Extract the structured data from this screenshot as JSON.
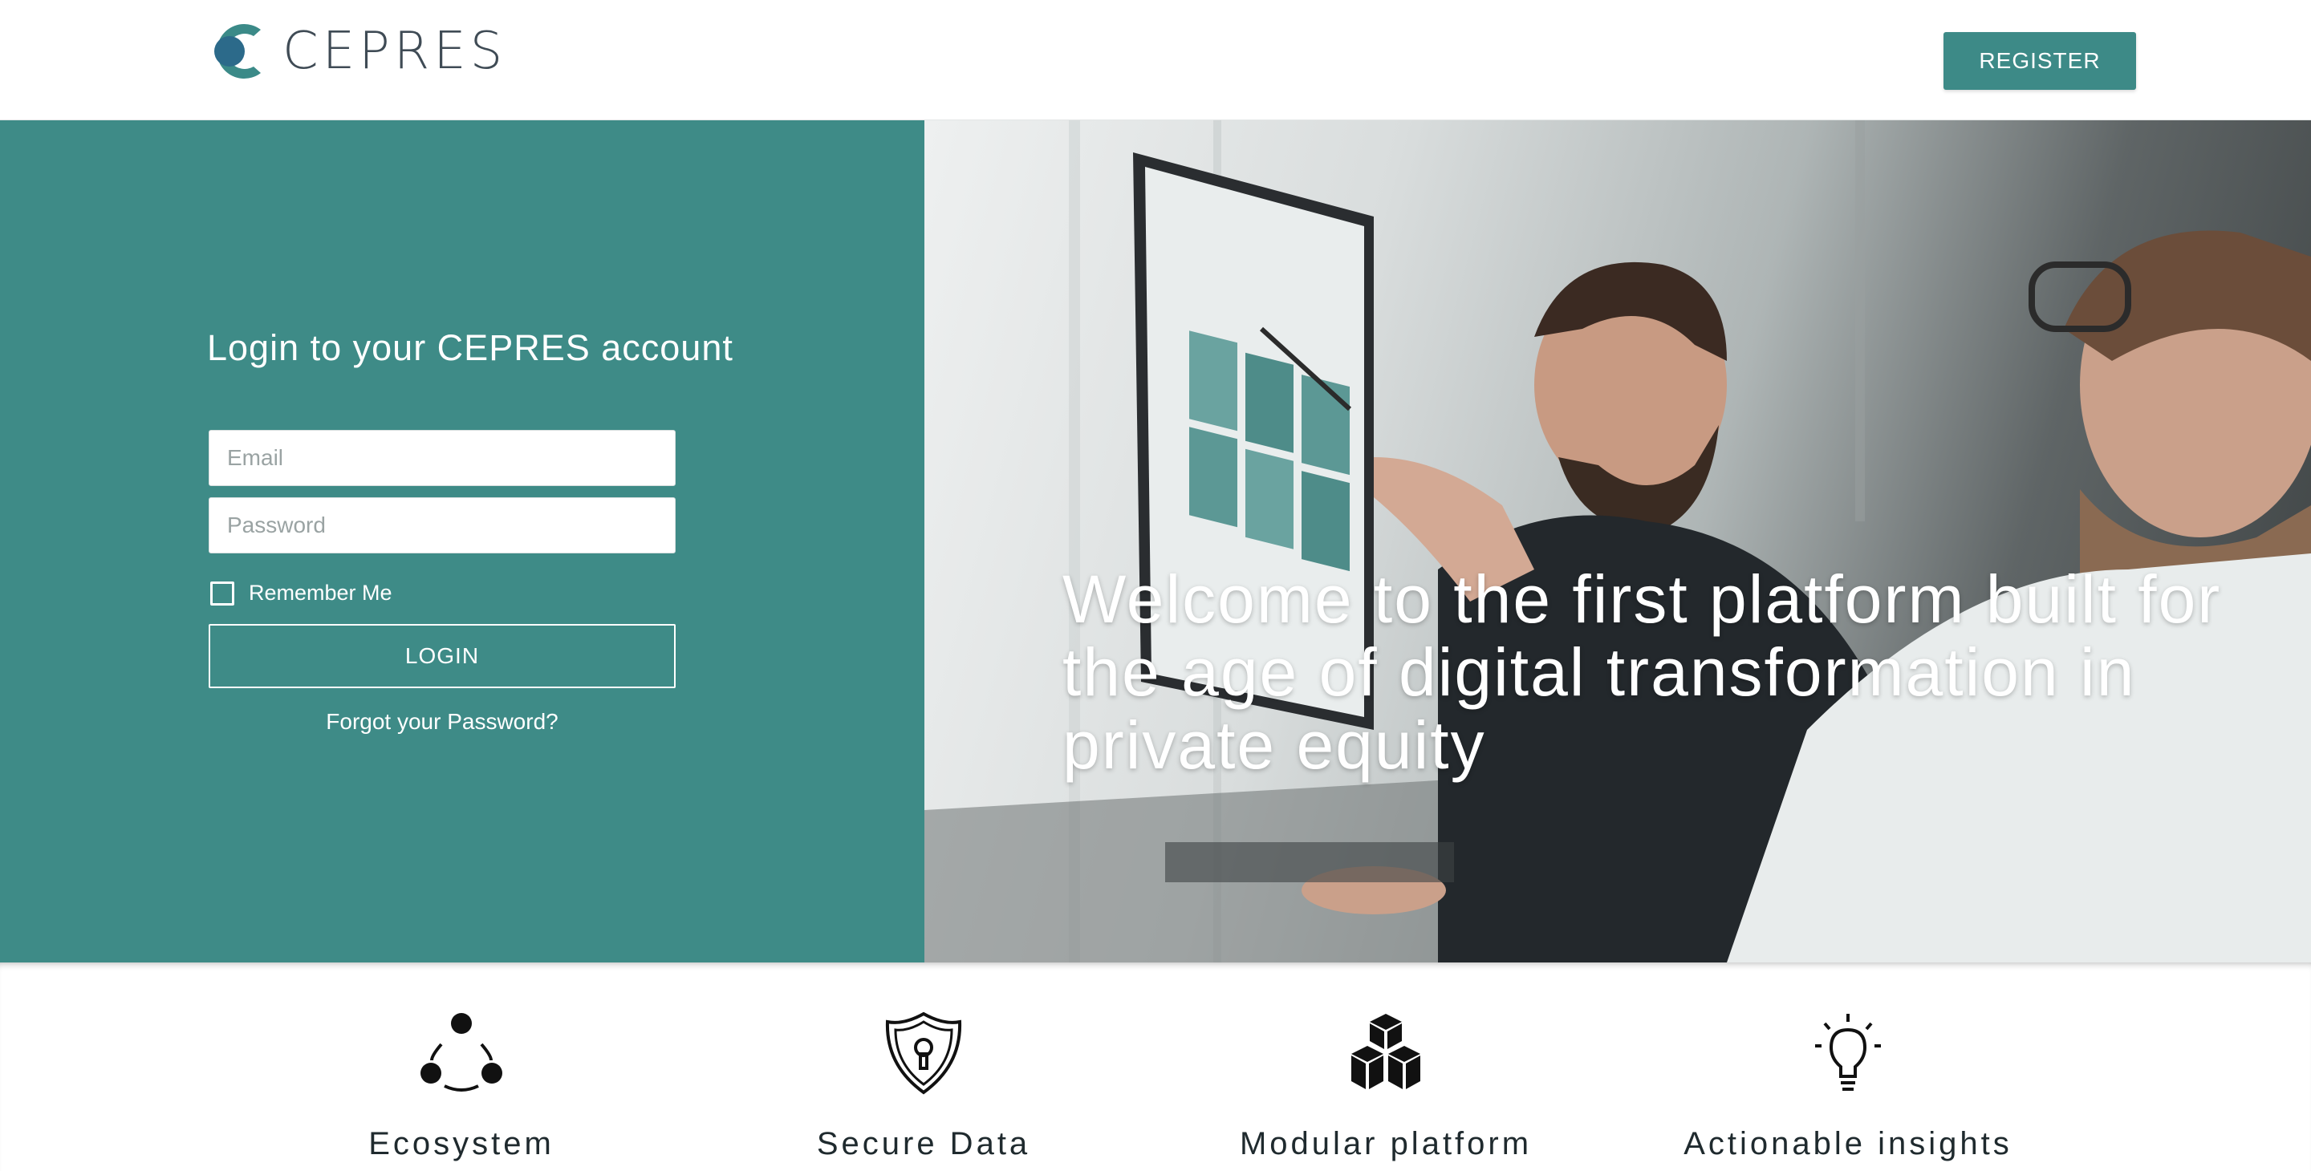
{
  "header": {
    "logo_text": "CEPRES",
    "register_label": "REGISTER"
  },
  "login": {
    "title": "Login to your CEPRES account",
    "email_placeholder": "Email",
    "password_placeholder": "Password",
    "remember_label": "Remember Me",
    "login_label": "LOGIN",
    "forgot_label": "Forgot your Password?"
  },
  "hero": {
    "welcome": "Welcome to the first platform built for the age of digital transformation in private equity"
  },
  "features": [
    {
      "label": "Ecosystem",
      "icon": "ecosystem-icon"
    },
    {
      "label": "Secure Data",
      "icon": "shield-lock-icon"
    },
    {
      "label": "Modular platform",
      "icon": "cubes-icon"
    },
    {
      "label": "Actionable insights",
      "icon": "lightbulb-icon"
    }
  ],
  "colors": {
    "accent": "#3e8b87",
    "header_logo": "#3f4b55"
  }
}
